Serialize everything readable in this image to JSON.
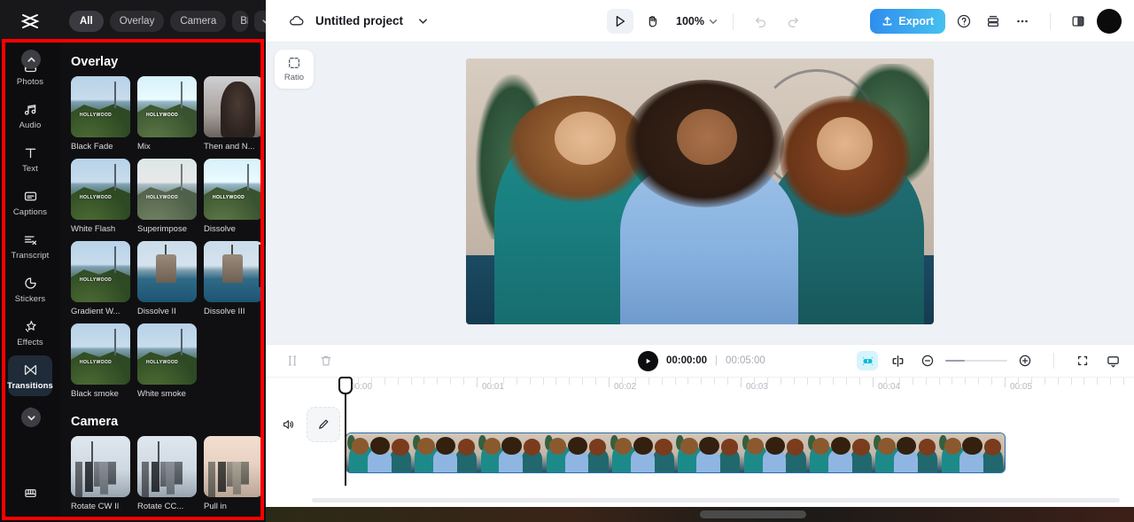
{
  "app": {
    "logo": "capcut-logo"
  },
  "library_filters": {
    "chips": [
      {
        "label": "All",
        "selected": true
      },
      {
        "label": "Overlay",
        "selected": false
      },
      {
        "label": "Camera",
        "selected": false
      },
      {
        "label": "Blu",
        "selected": false
      }
    ],
    "more_icon": "chevron-down-icon"
  },
  "sidebar": {
    "items": [
      {
        "label": "Photos",
        "icon": "photo-icon",
        "active": false,
        "badge": "chevron-up-icon"
      },
      {
        "label": "Audio",
        "icon": "music-note-icon",
        "active": false
      },
      {
        "label": "Text",
        "icon": "text-t-icon",
        "active": false
      },
      {
        "label": "Captions",
        "icon": "captions-icon",
        "active": false
      },
      {
        "label": "Transcript",
        "icon": "transcript-scissors-icon",
        "active": false
      },
      {
        "label": "Stickers",
        "icon": "sticker-icon",
        "active": false
      },
      {
        "label": "Effects",
        "icon": "sparkle-star-icon",
        "active": false
      },
      {
        "label": "Transitions",
        "icon": "transitions-icon",
        "active": true
      },
      {
        "label": "",
        "icon": "filters-circles-icon",
        "active": false,
        "badge": "chevron-down-icon"
      }
    ],
    "bottom_item": {
      "label": "",
      "icon": "keyboard-icon"
    }
  },
  "library": {
    "sections": [
      {
        "title": "Overlay",
        "items": [
          {
            "label": "Black Fade",
            "art": "hill"
          },
          {
            "label": "Mix",
            "art": "hill-faded"
          },
          {
            "label": "Then and N...",
            "art": "portrait"
          },
          {
            "label": "White Flash",
            "art": "hill"
          },
          {
            "label": "Superimpose",
            "art": "hill-faded"
          },
          {
            "label": "Dissolve",
            "art": "hill-faded2"
          },
          {
            "label": "Gradient W...",
            "art": "hill"
          },
          {
            "label": "Dissolve II",
            "art": "sea"
          },
          {
            "label": "Dissolve III",
            "art": "sea"
          },
          {
            "label": "Black smoke",
            "art": "hill"
          },
          {
            "label": "White smoke",
            "art": "hill"
          }
        ]
      },
      {
        "title": "Camera",
        "items": [
          {
            "label": "Rotate CW II",
            "art": "city"
          },
          {
            "label": "Rotate CC...",
            "art": "city"
          },
          {
            "label": "Pull in",
            "art": "city2"
          }
        ]
      }
    ]
  },
  "topbar": {
    "cloud_icon": "cloud-sync-icon",
    "project_name": "Untitled project",
    "project_dropdown_icon": "chevron-down-icon",
    "select_tool_icon": "cursor-arrow-icon",
    "hand_tool_icon": "hand-icon",
    "zoom_level": "100%",
    "zoom_dropdown_icon": "chevron-down-icon",
    "undo_icon": "undo-icon",
    "redo_icon": "redo-icon",
    "export_label": "Export",
    "export_icon": "upload-icon",
    "export_color": "#2f8ced",
    "help_icon": "question-circle-icon",
    "layers_icon": "stack-icon",
    "more_icon": "ellipsis-icon",
    "panel_toggle_icon": "split-panel-icon",
    "avatar_icon": "avatar"
  },
  "stage": {
    "ratio_label": "Ratio",
    "ratio_icon": "dashed-square-icon"
  },
  "timeline": {
    "split_icon": "split-icon",
    "delete_icon": "trash-icon",
    "play_icon": "play-icon",
    "current_time": "00:00:00",
    "time_separator": "|",
    "total_time": "00:05:00",
    "magic_icon": "auto-cut-icon",
    "split_clip_icon": "split-clip-icon",
    "zoom_out_icon": "minus-circle-icon",
    "zoom_in_icon": "plus-circle-icon",
    "fit_icon": "fit-screen-icon",
    "preview_icon": "monitor-icon",
    "ruler_labels": [
      "00:00",
      "00:01",
      "00:02",
      "00:03",
      "00:04",
      "00:05"
    ],
    "track": {
      "volume_icon": "speaker-icon",
      "edit_icon": "pencil-icon",
      "clip_name": "video-clip"
    }
  }
}
